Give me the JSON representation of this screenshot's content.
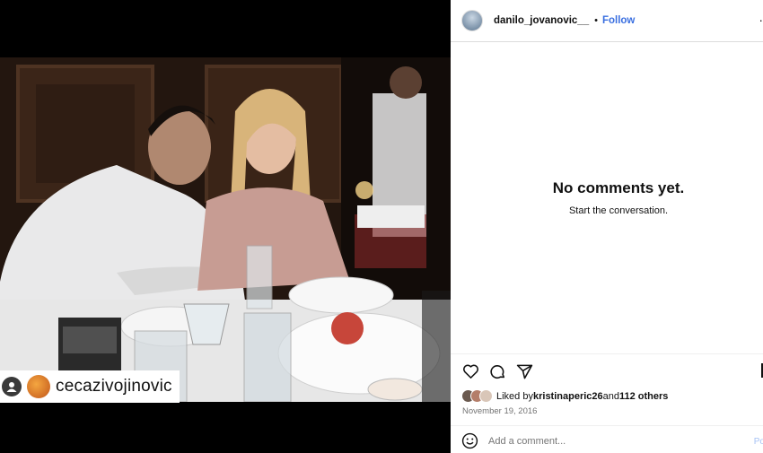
{
  "media": {
    "tagged_user": "cecazivojinovic"
  },
  "header": {
    "username": "danilo_jovanovic__",
    "separator": "•",
    "follow_label": "Follow",
    "more_label": "·"
  },
  "comments": {
    "empty_title": "No comments yet.",
    "empty_subtitle": "Start the conversation."
  },
  "likes": {
    "prefix": "Liked by ",
    "user": "kristinaperic26",
    "connector": " and ",
    "others": "112 others"
  },
  "date": "November 19, 2016",
  "comment_bar": {
    "placeholder": "Add a comment...",
    "post_label": "Po"
  },
  "icons": {
    "like": "heart-icon",
    "comment": "comment-icon",
    "share": "share-icon",
    "save": "bookmark-icon",
    "emoji": "emoji-icon"
  }
}
